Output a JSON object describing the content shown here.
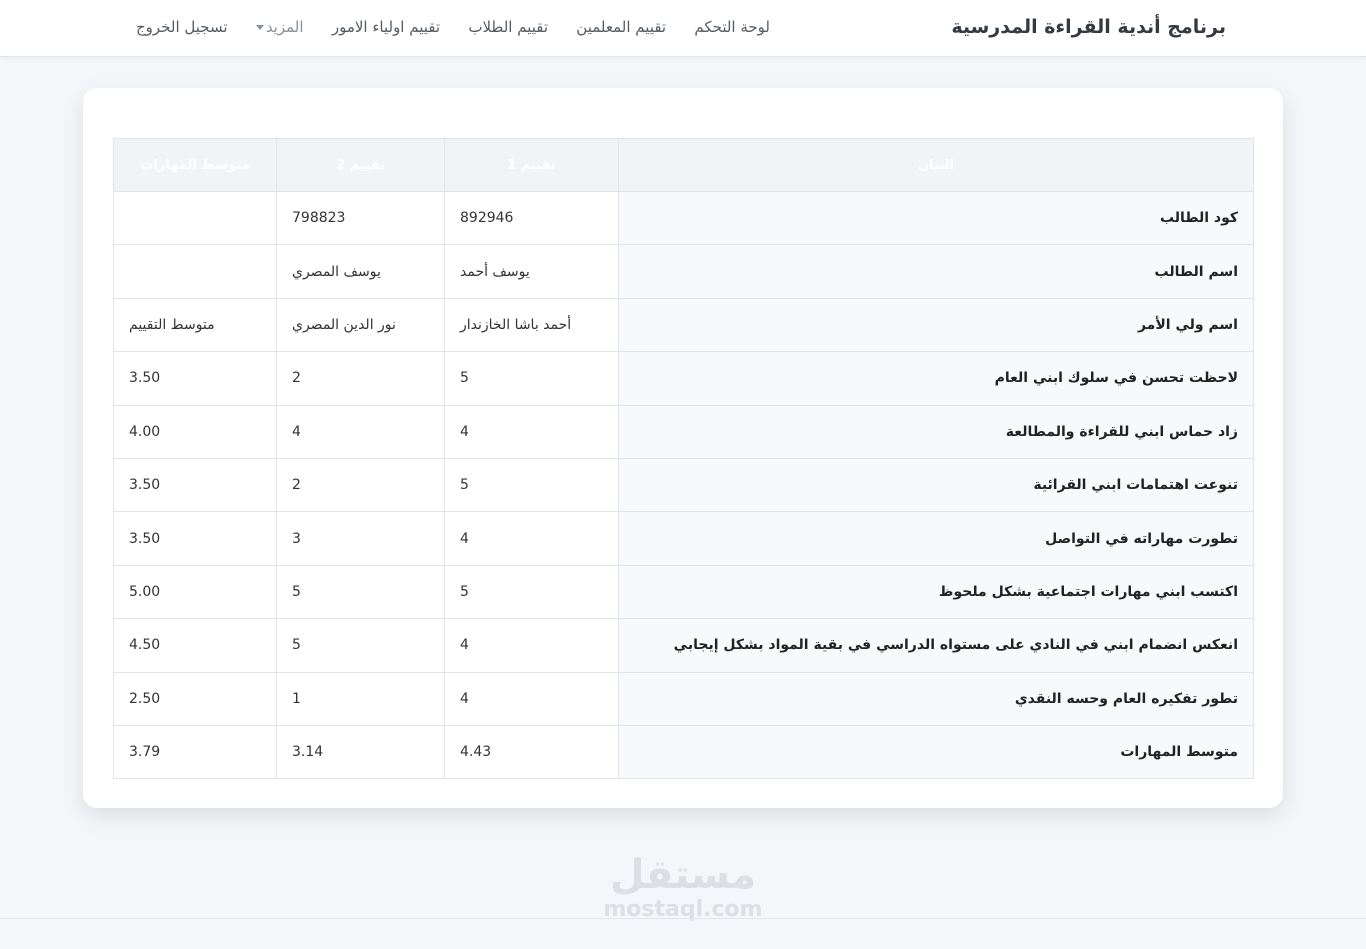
{
  "navbar": {
    "brand": "برنامج أندية القراءة المدرسية",
    "links": [
      "لوحة التحكم",
      "تقييم المعلمين",
      "تقييم الطلاب",
      "تقييم اولياء الامور",
      "المزيد",
      "تسجيل الخروج"
    ]
  },
  "table": {
    "headers": [
      "البيان",
      "تقييم 1",
      "تقييم 2",
      "متوسط المهارات"
    ],
    "rows": [
      {
        "label": "كود الطالب",
        "v1": "892946",
        "v2": "798823",
        "avg": ""
      },
      {
        "label": "اسم الطالب",
        "v1": "يوسف أحمد",
        "v2": "يوسف المصري",
        "avg": ""
      },
      {
        "label": "اسم ولي الأمر",
        "v1": "أحمد باشا الخازندار",
        "v2": "نور الدين المصري",
        "avg": "متوسط التقييم"
      },
      {
        "label": "لاحظت تحسن في سلوك ابني العام",
        "v1": "5",
        "v2": "2",
        "avg": "3.50"
      },
      {
        "label": "زاد حماس ابني للقراءة والمطالعة",
        "v1": "4",
        "v2": "4",
        "avg": "4.00"
      },
      {
        "label": "تنوعت اهتمامات ابني القرائية",
        "v1": "5",
        "v2": "2",
        "avg": "3.50"
      },
      {
        "label": "تطورت مهاراته في التواصل",
        "v1": "4",
        "v2": "3",
        "avg": "3.50"
      },
      {
        "label": "اكتسب ابني مهارات اجتماعية بشكل ملحوظ",
        "v1": "5",
        "v2": "5",
        "avg": "5.00"
      },
      {
        "label": "انعكس انضمام ابني في النادي على مستواه الدراسي في بقية المواد بشكل إيجابي",
        "v1": "4",
        "v2": "5",
        "avg": "4.50"
      },
      {
        "label": "تطور تفكيره العام وحسه النقدي",
        "v1": "4",
        "v2": "1",
        "avg": "2.50"
      },
      {
        "label": "متوسط المهارات",
        "v1": "4.43",
        "v2": "3.14",
        "avg": "3.79"
      }
    ]
  },
  "watermark": {
    "arabic": "مستقل",
    "latin": "mostaql.com"
  }
}
